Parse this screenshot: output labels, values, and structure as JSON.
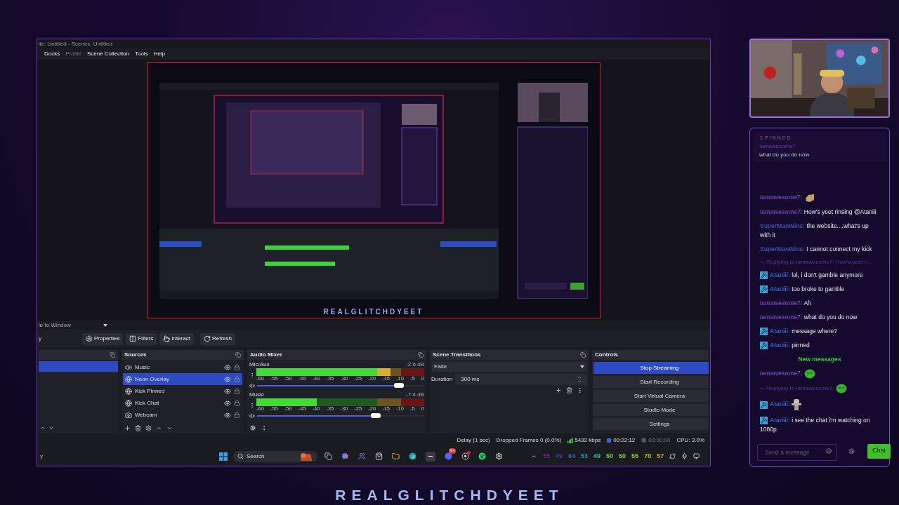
{
  "obs": {
    "title": "ile: Untitled - Scenes: Untitled",
    "menu": [
      {
        "label": "Docks",
        "disabled": false
      },
      {
        "label": "Profile",
        "disabled": true
      },
      {
        "label": "Scene Collection",
        "disabled": false
      },
      {
        "label": "Tools",
        "disabled": false
      },
      {
        "label": "Help",
        "disabled": false
      }
    ],
    "preview": {
      "canvas_text": "REALGLITCHDYEET"
    },
    "scale_mode": "le to Window",
    "toolbar_left": "y",
    "toolbar": [
      {
        "label": "Properties"
      },
      {
        "label": "Filters"
      },
      {
        "label": "Interact"
      },
      {
        "label": "Refresh"
      }
    ],
    "scenes": {
      "rows": [
        {
          "selected": true
        }
      ]
    },
    "sources": {
      "title": "Sources",
      "items": [
        {
          "name": "Music",
          "kind": "audio",
          "selected": false
        },
        {
          "name": "Neon Overlay",
          "kind": "browser",
          "selected": true
        },
        {
          "name": "Kick Pinned",
          "kind": "browser",
          "selected": false
        },
        {
          "name": "Kick Chat",
          "kind": "browser",
          "selected": false
        },
        {
          "name": "Webcam",
          "kind": "camera",
          "selected": false
        }
      ]
    },
    "audio_mixer": {
      "title": "Audio Mixer",
      "channels": [
        {
          "name": "Mic/Aux",
          "reading": "-2.6 dB",
          "meter": {
            "level": 0.8
          },
          "volume": {
            "level": 0.85
          },
          "scale": [
            "-60",
            "-55",
            "-50",
            "-45",
            "-40",
            "-35",
            "-30",
            "-25",
            "-20",
            "-15",
            "-10",
            "-5",
            "0"
          ]
        },
        {
          "name": "Music",
          "reading": "-7.4 dB",
          "meter": {
            "level": 0.36
          },
          "volume": {
            "level": 0.71
          },
          "scale": [
            "-60",
            "-55",
            "-50",
            "-45",
            "-40",
            "-35",
            "-30",
            "-25",
            "-20",
            "-15",
            "-10",
            "-5",
            "0"
          ]
        }
      ]
    },
    "scene_transitions": {
      "title": "Scene Transitions",
      "transition": "Fade",
      "duration_label": "Duration",
      "duration": "300 ms"
    },
    "controls": {
      "title": "Controls",
      "buttons": [
        {
          "label": "Stop Streaming",
          "active": true
        },
        {
          "label": "Start Recording",
          "active": false
        },
        {
          "label": "Start Virtual Camera",
          "active": false
        },
        {
          "label": "Studio Mode",
          "active": false
        },
        {
          "label": "Settings",
          "active": false
        }
      ]
    },
    "status_bar": {
      "delay": "Delay (1 sec)",
      "dropped": "Dropped Frames 0 (0.0%)",
      "bitrate": "5432 kbps",
      "stream_time": "00:22:12",
      "record_time": "00:00:00",
      "cpu": "CPU: 3.0%"
    },
    "taskbar": {
      "left_text": "y",
      "search": "Search",
      "discord_badge": "9+",
      "tray_numbers": [
        {
          "text": "35",
          "color": "#6a1fb0"
        },
        {
          "text": "49",
          "color": "#4c2fb8"
        },
        {
          "text": "64",
          "color": "#2f5fc0"
        },
        {
          "text": "53",
          "color": "#2f8fc0"
        },
        {
          "text": "49",
          "color": "#3fb8a0"
        },
        {
          "text": "50",
          "color": "#6ad040"
        },
        {
          "text": "50",
          "color": "#7ad030"
        },
        {
          "text": "55",
          "color": "#8ad020"
        },
        {
          "text": "70",
          "color": "#b0c020"
        },
        {
          "text": "57",
          "color": "#c0b020"
        }
      ]
    }
  },
  "chat": {
    "pinned": {
      "label": "PINNED",
      "user": "Iamawesome7",
      "text": "what do you do now"
    },
    "items": [
      {
        "kind": "message",
        "user": "Iamawesome7:",
        "color": "#6b3fb0",
        "badge": false,
        "emote": {
          "kind": "hand"
        }
      },
      {
        "kind": "message",
        "user": "Iamawesome7:",
        "color": "#6b3fb0",
        "badge": false,
        "text": "How's yeet rinsing @Ataniii"
      },
      {
        "kind": "message",
        "user": "SuperManWins:",
        "color": "#3d4fa8",
        "badge": false,
        "text": "the website....what's up with it"
      },
      {
        "kind": "message",
        "user": "SuperManWins:",
        "color": "#3d4fa8",
        "badge": false,
        "text": "I cannot connect my kick"
      },
      {
        "kind": "reply",
        "text": "Replying to Iamawesome7: How's yeet ri..."
      },
      {
        "kind": "message",
        "user": "Ataniii:",
        "color": "#3f5fc0",
        "badge": true,
        "text": "lol, i don't gamble anymore"
      },
      {
        "kind": "message",
        "user": "Ataniii:",
        "color": "#3f5fc0",
        "badge": true,
        "text": "too broke to gamble"
      },
      {
        "kind": "message",
        "user": "Iamawesome7:",
        "color": "#6b3fb0",
        "badge": false,
        "text": "Ah"
      },
      {
        "kind": "message",
        "user": "Iamawesome7:",
        "color": "#6b3fb0",
        "badge": false,
        "text": "what do you do now"
      },
      {
        "kind": "message",
        "user": "Ataniii:",
        "color": "#3f5fc0",
        "badge": true,
        "text": "message where?"
      },
      {
        "kind": "message",
        "user": "Ataniii:",
        "color": "#3f5fc0",
        "badge": true,
        "text": "pinned"
      },
      {
        "kind": "divider",
        "text": "New messages"
      },
      {
        "kind": "message",
        "user": "Iamawesome7:",
        "color": "#6b3fb0",
        "badge": false,
        "emote": {
          "kind": "blob"
        }
      },
      {
        "kind": "reply",
        "text": "Replying to Iamawesome7:",
        "emote": {
          "kind": "blob"
        }
      },
      {
        "kind": "message",
        "user": "Ataniii:",
        "color": "#3f5fc0",
        "badge": true,
        "emote": {
          "kind": "figure"
        }
      },
      {
        "kind": "message",
        "user": "Ataniii:",
        "color": "#3f5fc0",
        "badge": true,
        "text": "i see the chat i'm watching on 1080p"
      }
    ],
    "input": {
      "placeholder": "Send a message"
    },
    "send": "Chat"
  },
  "brand": "REALGLITCHDYEET"
}
